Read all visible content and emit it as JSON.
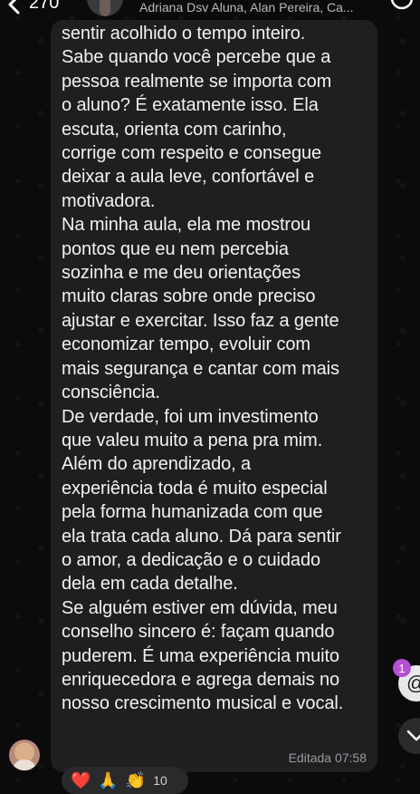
{
  "header": {
    "back_count": "270",
    "subtitle": "Adriana Dsv Aluna, Alan Pereira, Ca..."
  },
  "message": {
    "text": "sentir acolhido o tempo inteiro.\nSabe quando você percebe que a\npessoa realmente se importa com\no aluno? É exatamente isso. Ela\nescuta, orienta com carinho,\ncorrige com respeito e consegue\ndeixar a aula leve, confortável e\nmotivadora.\nNa minha aula, ela me mostrou\npontos que eu nem percebia\nsozinha e me deu orientações\nmuito claras sobre onde preciso\najustar e exercitar. Isso faz a gente\neconomizar tempo, evoluir com\nmais segurança e cantar com mais\nconsciência.\nDe verdade, foi um investimento\nque valeu muito a pena pra mim.\nAlém do aprendizado, a\nexperiência toda é muito especial\npela forma humanizada com que\nela trata cada aluno. Dá para sentir\no amor, a dedicação e o cuidado\ndela em cada detalhe.\nSe alguém estiver em dúvida, meu\nconselho sincero é: façam quando\npuderem. É uma experiência muito\nenriquecedora e agrega demais no\nnosso crescimento musical e vocal.",
    "footer": "Editada 07:58"
  },
  "reactions": {
    "emojis": [
      "❤️",
      "🙏",
      "👏"
    ],
    "count": "10"
  },
  "mentions": {
    "badge_count": "1",
    "symbol": "@"
  },
  "icons": {
    "back": "chevron-left-icon",
    "call": "call-icon",
    "scroll": "chevron-down-icon"
  }
}
